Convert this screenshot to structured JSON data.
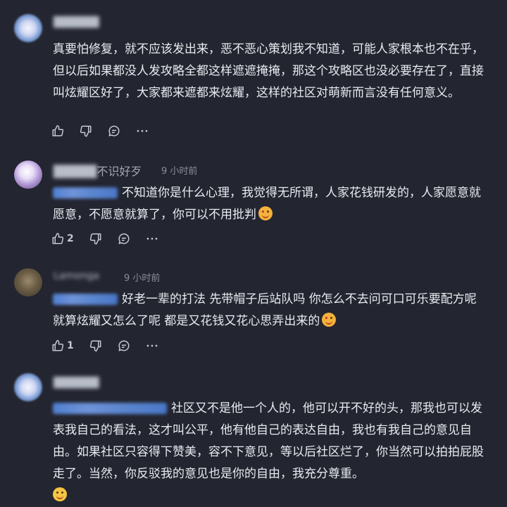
{
  "comments": [
    {
      "username": "██████",
      "time": "",
      "mention": "",
      "text": "真要怕修复，就不应该发出来，恶不恶心策划我不知道，可能人家根本也不在乎，但以后如果都没人发攻略全都这样遮遮掩掩，那这个攻略区也没必要存在了，直接叫炫耀区好了，大家都来遮都来炫耀，这样的社区对萌新而言没有任何意义。",
      "like_count": "",
      "emoji": ""
    },
    {
      "username_blur": "█████",
      "username_visible": "不识好歹",
      "time": "9 小时前",
      "text": "不知道你是什么心理，我觉得无所谓，人家花钱研发的，人家愿意就愿意，不愿意就算了，你可以不用批判",
      "like_count": "2",
      "emoji": "blush"
    },
    {
      "username": "Lamonga",
      "time": "9 小时前",
      "text": "好老一辈的打法 先带帽子后站队吗 你怎么不去问可口可乐要配方呢 就算炫耀又怎么了呢 都是又花钱又花心思弄出来的",
      "like_count": "1",
      "emoji": "blush"
    },
    {
      "username": "██████",
      "time": "",
      "text": "社区又不是他一个人的，他可以开不好的头，那我也可以发表我自己的看法，这才叫公平，他有他自己的表达自由，我也有我自己的意见自由。如果社区只容得下赞美，容不下意见，等以后社区烂了，你当然可以拍拍屁股走了。当然，你反驳我的意见也是你的自由，我充分尊重。",
      "like_count": "",
      "emoji": "smile"
    }
  ],
  "icons": [
    "thumbs-up-icon",
    "thumbs-down-icon",
    "comment-icon",
    "more-icon"
  ]
}
